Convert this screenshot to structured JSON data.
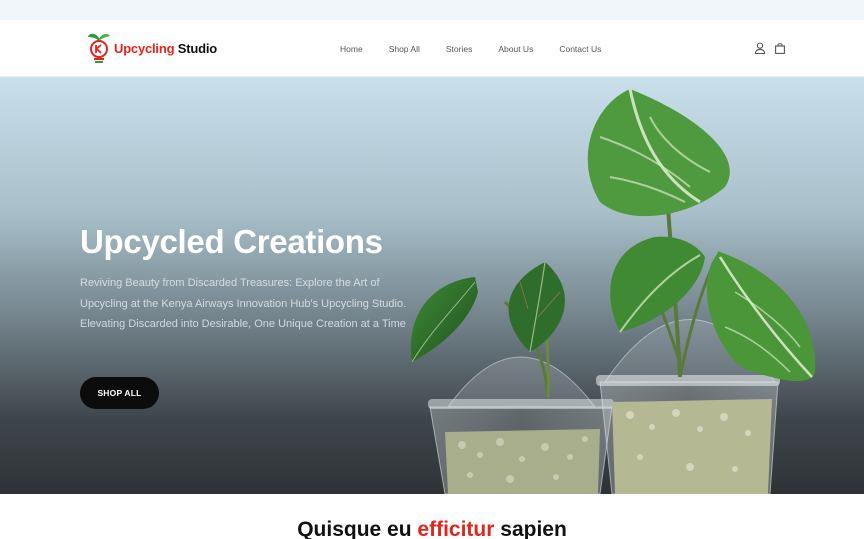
{
  "brand": {
    "name_part1": "Upcycling",
    "name_part2": "Studio",
    "colors": {
      "accent": "#e1251b",
      "logo_green": "#2a9a3c",
      "text": "#111111"
    }
  },
  "nav": {
    "items": [
      {
        "label": "Home"
      },
      {
        "label": "Shop All"
      },
      {
        "label": "Stories"
      },
      {
        "label": "About Us"
      },
      {
        "label": "Contact Us"
      }
    ]
  },
  "header_icons": {
    "account": "user-icon",
    "cart": "shopping-bag-icon"
  },
  "hero": {
    "title": "Upcycled Creations",
    "subtitle": "Reviving Beauty from Discarded Treasures: Explore the Art of Upcycling at the Kenya Airways Innovation Hub's Upcycling Studio. Elevating Discarded into Desirable, One Unique Creation at a Time",
    "button_label": "SHOP ALL",
    "image_alt": "two plants in clear upcycled cups"
  },
  "section": {
    "heading_part1": "Quisque eu",
    "heading_accent": "efficitur",
    "heading_part2": "sapien"
  }
}
